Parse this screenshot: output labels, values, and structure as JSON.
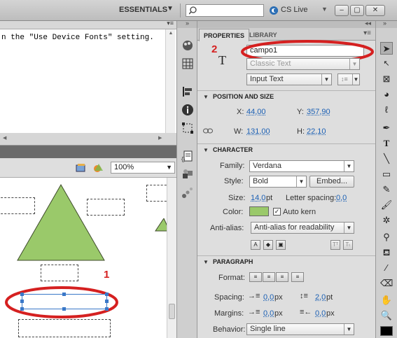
{
  "topbar": {
    "workspace": "ESSENTIALS",
    "search_placeholder": "",
    "cslive": "CS Live"
  },
  "output": {
    "text": "n the \"Use Device Fonts\" setting."
  },
  "stage": {
    "zoom": "100%",
    "annotation_1": "1",
    "annotation_2": "2"
  },
  "properties": {
    "tab_properties": "PROPERTIES",
    "tab_library": "LIBRARY",
    "instance_name": "campo1",
    "text_engine": "Classic Text",
    "text_type": "Input Text",
    "sections": {
      "position_size": "POSITION AND SIZE",
      "character": "CHARACTER",
      "paragraph": "PARAGRAPH"
    },
    "position": {
      "x_label": "X:",
      "x_value": "44,00",
      "y_label": "Y:",
      "y_value": "357,90",
      "w_label": "W:",
      "w_value": "131,00",
      "h_label": "H:",
      "h_value": "22,10"
    },
    "character": {
      "family_label": "Family:",
      "family_value": "Verdana",
      "style_label": "Style:",
      "style_value": "Bold",
      "embed_button": "Embed...",
      "size_label": "Size:",
      "size_value": "14,0",
      "size_unit": "pt",
      "spacing_label": "Letter spacing:",
      "spacing_value": "0,0",
      "color_label": "Color:",
      "color_value": "#9ac96a",
      "autokern_label": "Auto kern",
      "antialias_label": "Anti-alias:",
      "antialias_value": "Anti-alias for readability"
    },
    "paragraph": {
      "format_label": "Format:",
      "spacing_label": "Spacing:",
      "spacing_indent": "0,0",
      "spacing_indent_unit": "px",
      "spacing_line": "2,0",
      "spacing_line_unit": "pt",
      "margins_label": "Margins:",
      "margin_left": "0,0",
      "margin_left_unit": "px",
      "margin_right": "0,0",
      "margin_right_unit": "px",
      "behavior_label": "Behavior:",
      "behavior_value": "Single line"
    }
  }
}
